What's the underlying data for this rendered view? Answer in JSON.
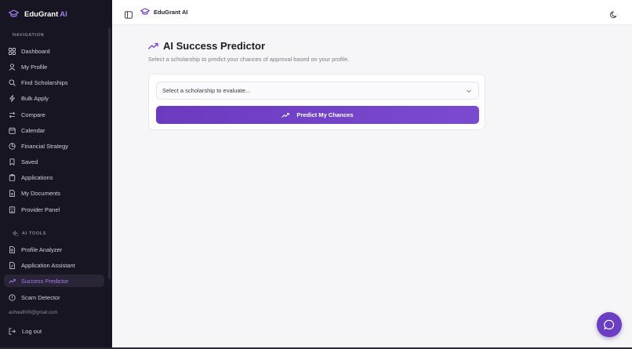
{
  "brand": {
    "name": "EduGrant",
    "suffix": "AI"
  },
  "topbar": {
    "title": "EduGrant AI"
  },
  "sidebar": {
    "nav_label": "NAVIGATION",
    "ai_label": "AI TOOLS",
    "items": [
      {
        "label": "Dashboard",
        "icon": "grid-icon"
      },
      {
        "label": "My Profile",
        "icon": "user-icon"
      },
      {
        "label": "Find Scholarships",
        "icon": "search-icon"
      },
      {
        "label": "Bulk Apply",
        "icon": "bolt-icon"
      },
      {
        "label": "Compare",
        "icon": "compare-icon"
      },
      {
        "label": "Calendar",
        "icon": "calendar-icon"
      },
      {
        "label": "Financial Strategy",
        "icon": "pie-icon"
      },
      {
        "label": "Saved",
        "icon": "bookmark-icon"
      },
      {
        "label": "Applications",
        "icon": "clipboard-icon"
      },
      {
        "label": "My Documents",
        "icon": "document-icon"
      },
      {
        "label": "Provider Panel",
        "icon": "building-icon"
      }
    ],
    "ai_items": [
      {
        "label": "Profile Analyzer",
        "icon": "file-search-icon"
      },
      {
        "label": "Application Assistant",
        "icon": "file-edit-icon"
      },
      {
        "label": "Success Predictor",
        "icon": "trend-icon",
        "active": true
      },
      {
        "label": "Scam Detector",
        "icon": "alert-icon"
      }
    ],
    "email": "ashwath00@gmail.com",
    "logout": "Log out"
  },
  "main": {
    "title": "AI Success Predictor",
    "subtitle": "Select a scholarship to predict your chances of approval based on your profile.",
    "select_placeholder": "Select a scholarship to evaluate...",
    "predict_button": "Predict My Chances"
  },
  "colors": {
    "accent": "#7a4bcf",
    "sidebar_bg": "#181523",
    "active_text": "#a779f0"
  }
}
